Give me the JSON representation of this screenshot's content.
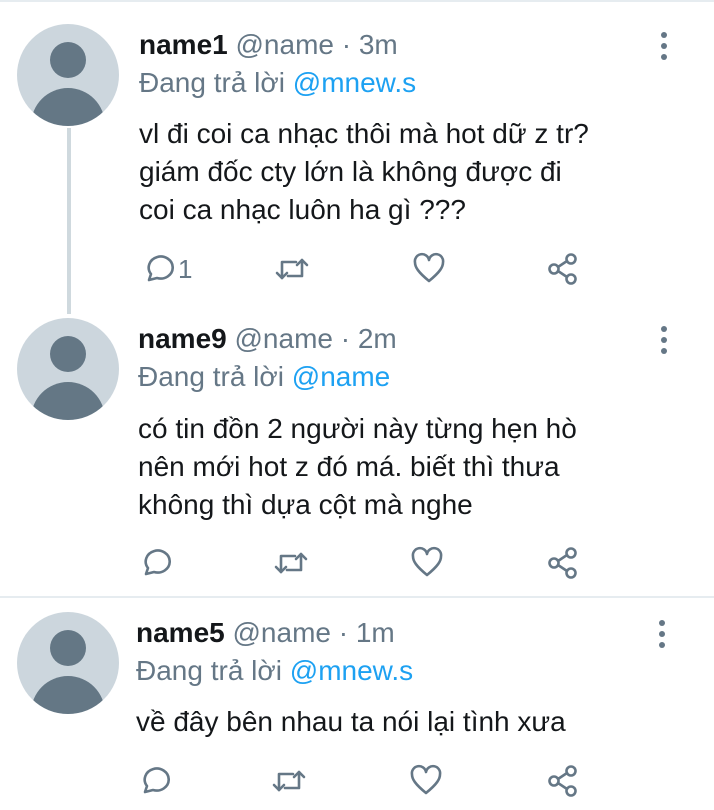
{
  "tweets": [
    {
      "name": "name1",
      "handle": "@name",
      "sep": "·",
      "time": "3m",
      "reply_prefix": "Đang trả lời",
      "reply_to": "@mnew.s",
      "lines": [
        "vl đi coi ca nhạc thôi mà hot dữ z tr?",
        "giám đốc cty lớn là không được đi",
        "coi ca nhạc luôn ha gì ???"
      ],
      "reply_count": "1"
    },
    {
      "name": "name9",
      "handle": "@name",
      "sep": "·",
      "time": "2m",
      "reply_prefix": "Đang trả lời",
      "reply_to": "@name",
      "lines": [
        "có tin đồn 2 người này từng hẹn hò",
        "nên mới hot z đó má. biết thì thưa",
        "không thì dựa cột mà nghe"
      ],
      "reply_count": ""
    },
    {
      "name": "name5",
      "handle": "@name",
      "sep": "·",
      "time": "1m",
      "reply_prefix": "Đang trả lời",
      "reply_to": "@mnew.s",
      "lines": [
        "về đây bên nhau ta nói lại tình xưa"
      ],
      "reply_count": ""
    }
  ],
  "icons": {
    "reply": "reply-icon",
    "retweet": "retweet-icon",
    "like": "heart-icon",
    "share": "share-icon",
    "more": "more-vertical-icon"
  },
  "colors": {
    "text": "#14171a",
    "secondary": "#657786",
    "link": "#1da1f2",
    "avatar_bg": "#ccd6dd",
    "avatar_fg": "#647785",
    "divider": "#e6ecf0"
  }
}
